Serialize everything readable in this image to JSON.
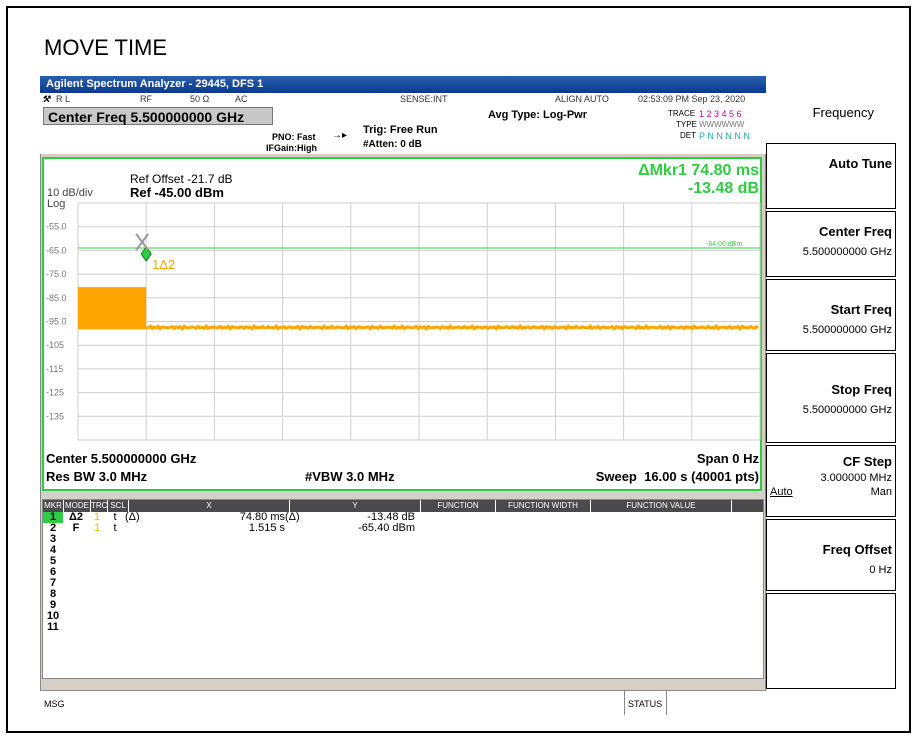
{
  "page_title": "MOVE TIME",
  "window_title": "Agilent Spectrum Analyzer - 29445, DFS 1",
  "status": {
    "rl": "R L",
    "rf": "RF",
    "ohm": "50 Ω",
    "ac": "AC",
    "sense": "SENSE:INT",
    "align": "ALIGN AUTO",
    "timestamp": "02:53:09 PM Sep 23, 2020"
  },
  "header": {
    "center_freq": "Center Freq 5.500000000 GHz",
    "pno": "PNO: Fast",
    "ifgain": "IFGain:High",
    "trig": "Trig: Free Run",
    "atten": "#Atten: 0 dB",
    "avg_type": "Avg Type: Log-Pwr",
    "trace_label": "TRACE",
    "trace_nums": "1 2 3 4 5 6",
    "type_label": "TYPE",
    "type_val": "WWWWWW",
    "det_label": "DET",
    "det_val": "P N N N N N"
  },
  "plot": {
    "ref_offset": "Ref Offset -21.7 dB",
    "ref_level": "Ref -45.00 dBm",
    "scale": "10 dB/div",
    "log": "Log",
    "marker_readout_1": "ΔMkr1 74.80 ms",
    "marker_readout_2": "-13.48 dB",
    "threshold_label": "-64.00 dBm",
    "marker_label": "1Δ2",
    "y_ticks": [
      "-55.0",
      "-65.0",
      "-75.0",
      "-85.0",
      "-95.0",
      "-105",
      "-115",
      "-125",
      "-135"
    ],
    "center": "Center 5.500000000 GHz",
    "span": "Span 0 Hz",
    "res_bw": "Res BW 3.0 MHz",
    "vbw": "#VBW 3.0 MHz",
    "sweep": "Sweep  16.00 s (40001 pts)"
  },
  "chart_data": {
    "type": "line",
    "ylabel": "",
    "xlabel": "",
    "ylim": [
      -145,
      -45
    ],
    "threshold_dbm": -64.0,
    "series": [
      {
        "x_fraction": [
          0.0,
          0.1,
          0.1,
          1.0
        ],
        "values": [
          -80.5,
          -80.5,
          -97.5,
          -97.5
        ]
      }
    ],
    "markers": [
      {
        "x_fraction": 0.1,
        "value": -66.5
      }
    ]
  },
  "marker_table": {
    "headers": [
      "MKR",
      "MODE",
      "TRC",
      "SCL",
      "X",
      "Y",
      "FUNCTION",
      "FUNCTION WIDTH",
      "FUNCTION VALUE"
    ],
    "rows": [
      {
        "mkr": "1",
        "mode": "Δ2",
        "trc": "1",
        "scl": "t",
        "xmode": "(Δ)",
        "x": "74.80 ms",
        "ymode": "(Δ)",
        "y": "-13.48 dB"
      },
      {
        "mkr": "2",
        "mode": "F",
        "trc": "1",
        "scl": "t",
        "xmode": "",
        "x": "1.515 s",
        "ymode": "",
        "y": "-65.40 dBm"
      },
      {
        "mkr": "3",
        "mode": "",
        "trc": "",
        "scl": "",
        "xmode": "",
        "x": "",
        "ymode": "",
        "y": ""
      },
      {
        "mkr": "4",
        "mode": "",
        "trc": "",
        "scl": "",
        "xmode": "",
        "x": "",
        "ymode": "",
        "y": ""
      },
      {
        "mkr": "5",
        "mode": "",
        "trc": "",
        "scl": "",
        "xmode": "",
        "x": "",
        "ymode": "",
        "y": ""
      },
      {
        "mkr": "6",
        "mode": "",
        "trc": "",
        "scl": "",
        "xmode": "",
        "x": "",
        "ymode": "",
        "y": ""
      },
      {
        "mkr": "7",
        "mode": "",
        "trc": "",
        "scl": "",
        "xmode": "",
        "x": "",
        "ymode": "",
        "y": ""
      },
      {
        "mkr": "8",
        "mode": "",
        "trc": "",
        "scl": "",
        "xmode": "",
        "x": "",
        "ymode": "",
        "y": ""
      },
      {
        "mkr": "9",
        "mode": "",
        "trc": "",
        "scl": "",
        "xmode": "",
        "x": "",
        "ymode": "",
        "y": ""
      },
      {
        "mkr": "10",
        "mode": "",
        "trc": "",
        "scl": "",
        "xmode": "",
        "x": "",
        "ymode": "",
        "y": ""
      },
      {
        "mkr": "11",
        "mode": "",
        "trc": "",
        "scl": "",
        "xmode": "",
        "x": "",
        "ymode": "",
        "y": ""
      }
    ]
  },
  "msg_bar": {
    "msg": "MSG",
    "status": "STATUS"
  },
  "softkeys": {
    "menu_title": "Frequency",
    "auto_tune": "Auto Tune",
    "center_freq": "Center Freq",
    "center_freq_val": "5.500000000 GHz",
    "start_freq": "Start Freq",
    "start_freq_val": "5.500000000 GHz",
    "stop_freq": "Stop Freq",
    "stop_freq_val": "5.500000000 GHz",
    "cf_step": "CF Step",
    "cf_step_val": "3.000000 MHz",
    "auto": "Auto",
    "man": "Man",
    "freq_offset": "Freq Offset",
    "freq_offset_val": "0 Hz"
  },
  "colors": {
    "trace": "#ffa500",
    "accent_green": "#2ecc40",
    "title_blue": "#0a3a8c"
  }
}
